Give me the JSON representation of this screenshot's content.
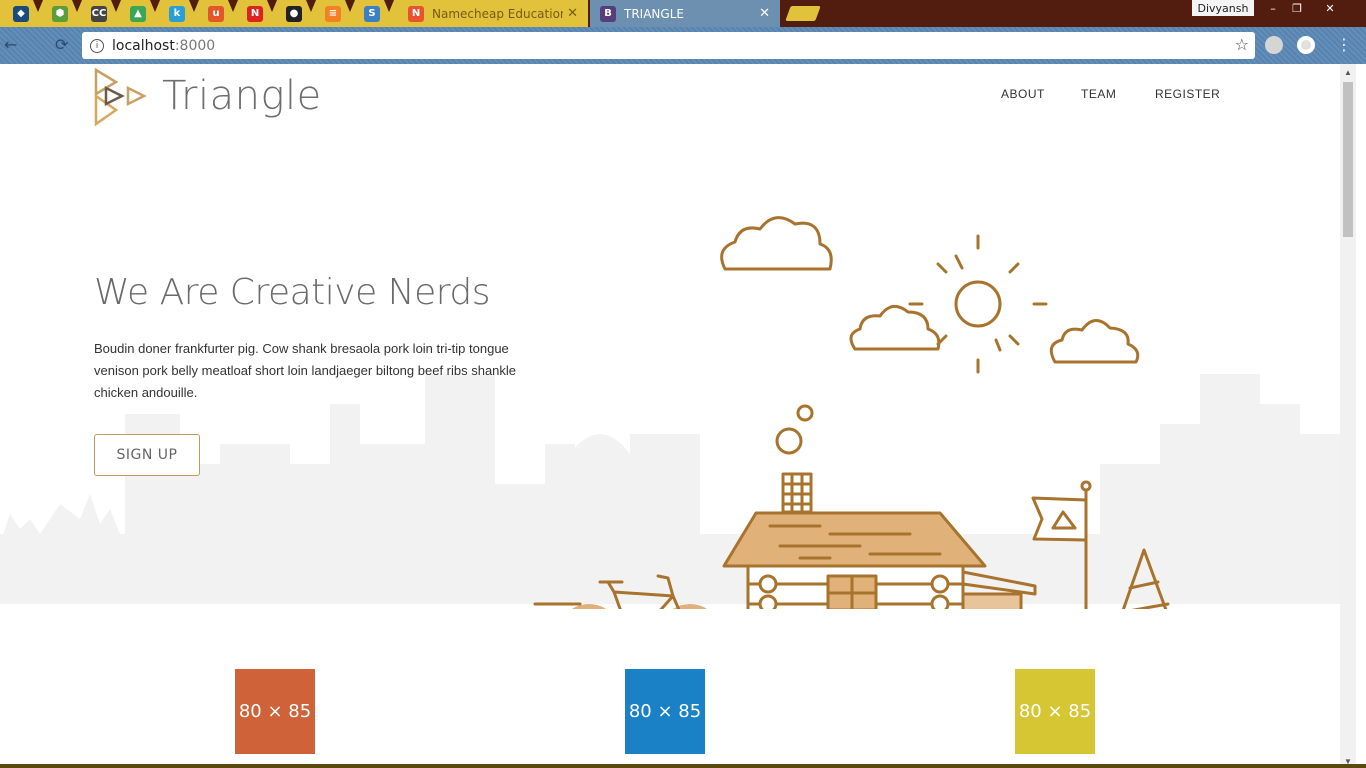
{
  "browser": {
    "pinned_tabs": [
      {
        "icon": "bird-icon",
        "color": "#1a4b7a",
        "glyph": "◆"
      },
      {
        "icon": "cube-icon",
        "color": "#5a9e3a",
        "glyph": "⬢"
      },
      {
        "icon": "cc-icon",
        "color": "#444444",
        "glyph": "CC"
      },
      {
        "icon": "drive-icon",
        "color": "#3aa757",
        "glyph": "▲"
      },
      {
        "icon": "k-icon",
        "color": "#2a9fd6",
        "glyph": "k"
      },
      {
        "icon": "u-icon",
        "color": "#e2562a",
        "glyph": "u"
      },
      {
        "icon": "n-icon",
        "color": "#d22",
        "glyph": "N"
      },
      {
        "icon": "github-icon",
        "color": "#222222",
        "glyph": "●"
      },
      {
        "icon": "stack-icon",
        "color": "#f48024",
        "glyph": "≡"
      },
      {
        "icon": "s-icon",
        "color": "#3b7fc4",
        "glyph": "S"
      }
    ],
    "tabs": [
      {
        "title": "Namecheap Education P",
        "favicon": "namecheap-icon",
        "favicon_color": "#e8522e",
        "favicon_glyph": "N"
      },
      {
        "title": "TRIANGLE",
        "favicon": "bootstrap-icon",
        "favicon_color": "#563d7c",
        "favicon_glyph": "B"
      }
    ],
    "profile": "Divyansh",
    "window": {
      "minimize": "–",
      "restore": "❐",
      "close": "✕"
    },
    "url_host": "localhost",
    "url_port": ":8000",
    "star": "☆",
    "back": "←",
    "reload": "⟳"
  },
  "site": {
    "logo_text": "Triangle",
    "nav": [
      "ABOUT",
      "TEAM",
      "REGISTER"
    ],
    "hero_title": "We Are Creative Nerds",
    "hero_body": "Boudin doner frankfurter pig. Cow shank bresaola pork loin tri-tip tongue venison pork belly meatloaf short loin landjaeger biltong beef ribs shankle chicken andouille.",
    "cta": "SIGN UP",
    "tiles": [
      {
        "label": "80 × 85",
        "color": "#cd5a2f"
      },
      {
        "label": "80 × 85",
        "color": "#0f7bc4"
      },
      {
        "label": "80 × 85",
        "color": "#d4c42a"
      }
    ],
    "accent": "#b07a32"
  }
}
